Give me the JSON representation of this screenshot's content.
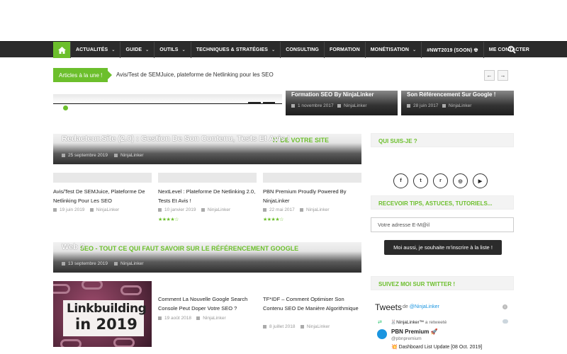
{
  "nav": {
    "items": [
      {
        "label": "ACTUALITÉS",
        "dropdown": true
      },
      {
        "label": "GUIDE",
        "dropdown": true
      },
      {
        "label": "OUTILS",
        "dropdown": true
      },
      {
        "label": "TECHNIQUES & STRATÉGIES",
        "dropdown": true
      },
      {
        "label": "CONSULTING",
        "dropdown": false
      },
      {
        "label": "FORMATION",
        "dropdown": false
      },
      {
        "label": "MONÉTISATION",
        "dropdown": true
      },
      {
        "label": "#NWT2019 (SOON) ☢",
        "dropdown": false
      },
      {
        "label": "ME CONTACTER",
        "dropdown": false
      }
    ],
    "accent": "#6cbf2c",
    "background": "#2b2b2b"
  },
  "ticker": {
    "label": "Articles à la une !",
    "text": "Avis/Test de SEMJuice, plateforme de Netlinking pour les SEO",
    "prev": "←",
    "next": "→"
  },
  "slider": {
    "cards": [
      {
        "title": "Formation SEO By NinjaLinker",
        "date": "1 novembre 2017",
        "author": "NinjaLinker"
      },
      {
        "title": "Son Référencement Sur Google !",
        "date": "28 juin 2017",
        "author": "NinjaLinker"
      }
    ]
  },
  "section1": {
    "heading": "IT DE VOTRE SITE",
    "featured_title": "Redacteur.Site (2.0) : Gestion De Son Contenu, Tests Et Avis !",
    "featured_date": "25 septembre 2019",
    "featured_author": "NinjaLinker",
    "posts": [
      {
        "title": "Avis/Test De SEMJuice, Plateforme De Netlinking Pour Les SEO",
        "date": "19 juin 2019",
        "author": "NinjaLinker",
        "stars": ""
      },
      {
        "title": "NextLevel : Plateforme De Netlinking 2.0, Tests Et Avis !",
        "date": "10 janvier 2019",
        "author": "NinjaLinker",
        "stars": "★★★★☆"
      },
      {
        "title": "PBN Premium Proudly Powered By NinjaLinker",
        "date": "22 mai 2017",
        "author": "NinjaLinker",
        "stars": "★★★★☆"
      }
    ]
  },
  "section2": {
    "heading": "SEO - TOUT CE QUI FAUT SAVOIR SUR LE RÉFÉRENCEMENT GOOGLE",
    "featured_title": "Web ?",
    "featured_date": "13 septembre 2019",
    "featured_author": "NinjaLinker",
    "image_line1": "Linkbuilding",
    "image_line2": "in 2019",
    "posts": [
      {
        "title": "Comment La Nouvelle Google Search Console Peut Doper Votre SEO ?",
        "date": "19 août 2018",
        "author": "NinjaLinker"
      },
      {
        "title": "TF*IDF – Comment Optimiser Son Contenu SEO De Manière Algorithmique",
        "date": "8 juillet 2018",
        "author": "NinjaLinker"
      }
    ]
  },
  "sidebar": {
    "about_heading": "QUI SUIS-JE ?",
    "socials": [
      {
        "icon": "facebook-icon",
        "glyph": "f"
      },
      {
        "icon": "twitter-icon",
        "glyph": "t"
      },
      {
        "icon": "reddit-icon",
        "glyph": "r"
      },
      {
        "icon": "instagram-icon",
        "glyph": "◎"
      },
      {
        "icon": "youtube-icon",
        "glyph": "▶"
      }
    ],
    "newsletter_heading": "RECEVOIR TIPS, ASTUCES, TUTORIELS...",
    "email_placeholder": "Votre adresse E-M@il",
    "subscribe_label": "Moi aussi, je souhaite m'inscrire à la liste !",
    "twitter_heading": "SUIVEZ MOI SUR TWITTER !",
    "tweets_title": "Tweets",
    "tweets_by_prefix": "de",
    "tweets_by": "@NinjaLinker",
    "retweet_author": "🐰NinjaLinker™",
    "retweet_text": "a retweeté",
    "tweet_name": "PBN Premium 🚀",
    "tweet_handle": "@pbnpremium",
    "tweet_text": "💥 Dashboard List Update [08 Oct. 2019]"
  }
}
